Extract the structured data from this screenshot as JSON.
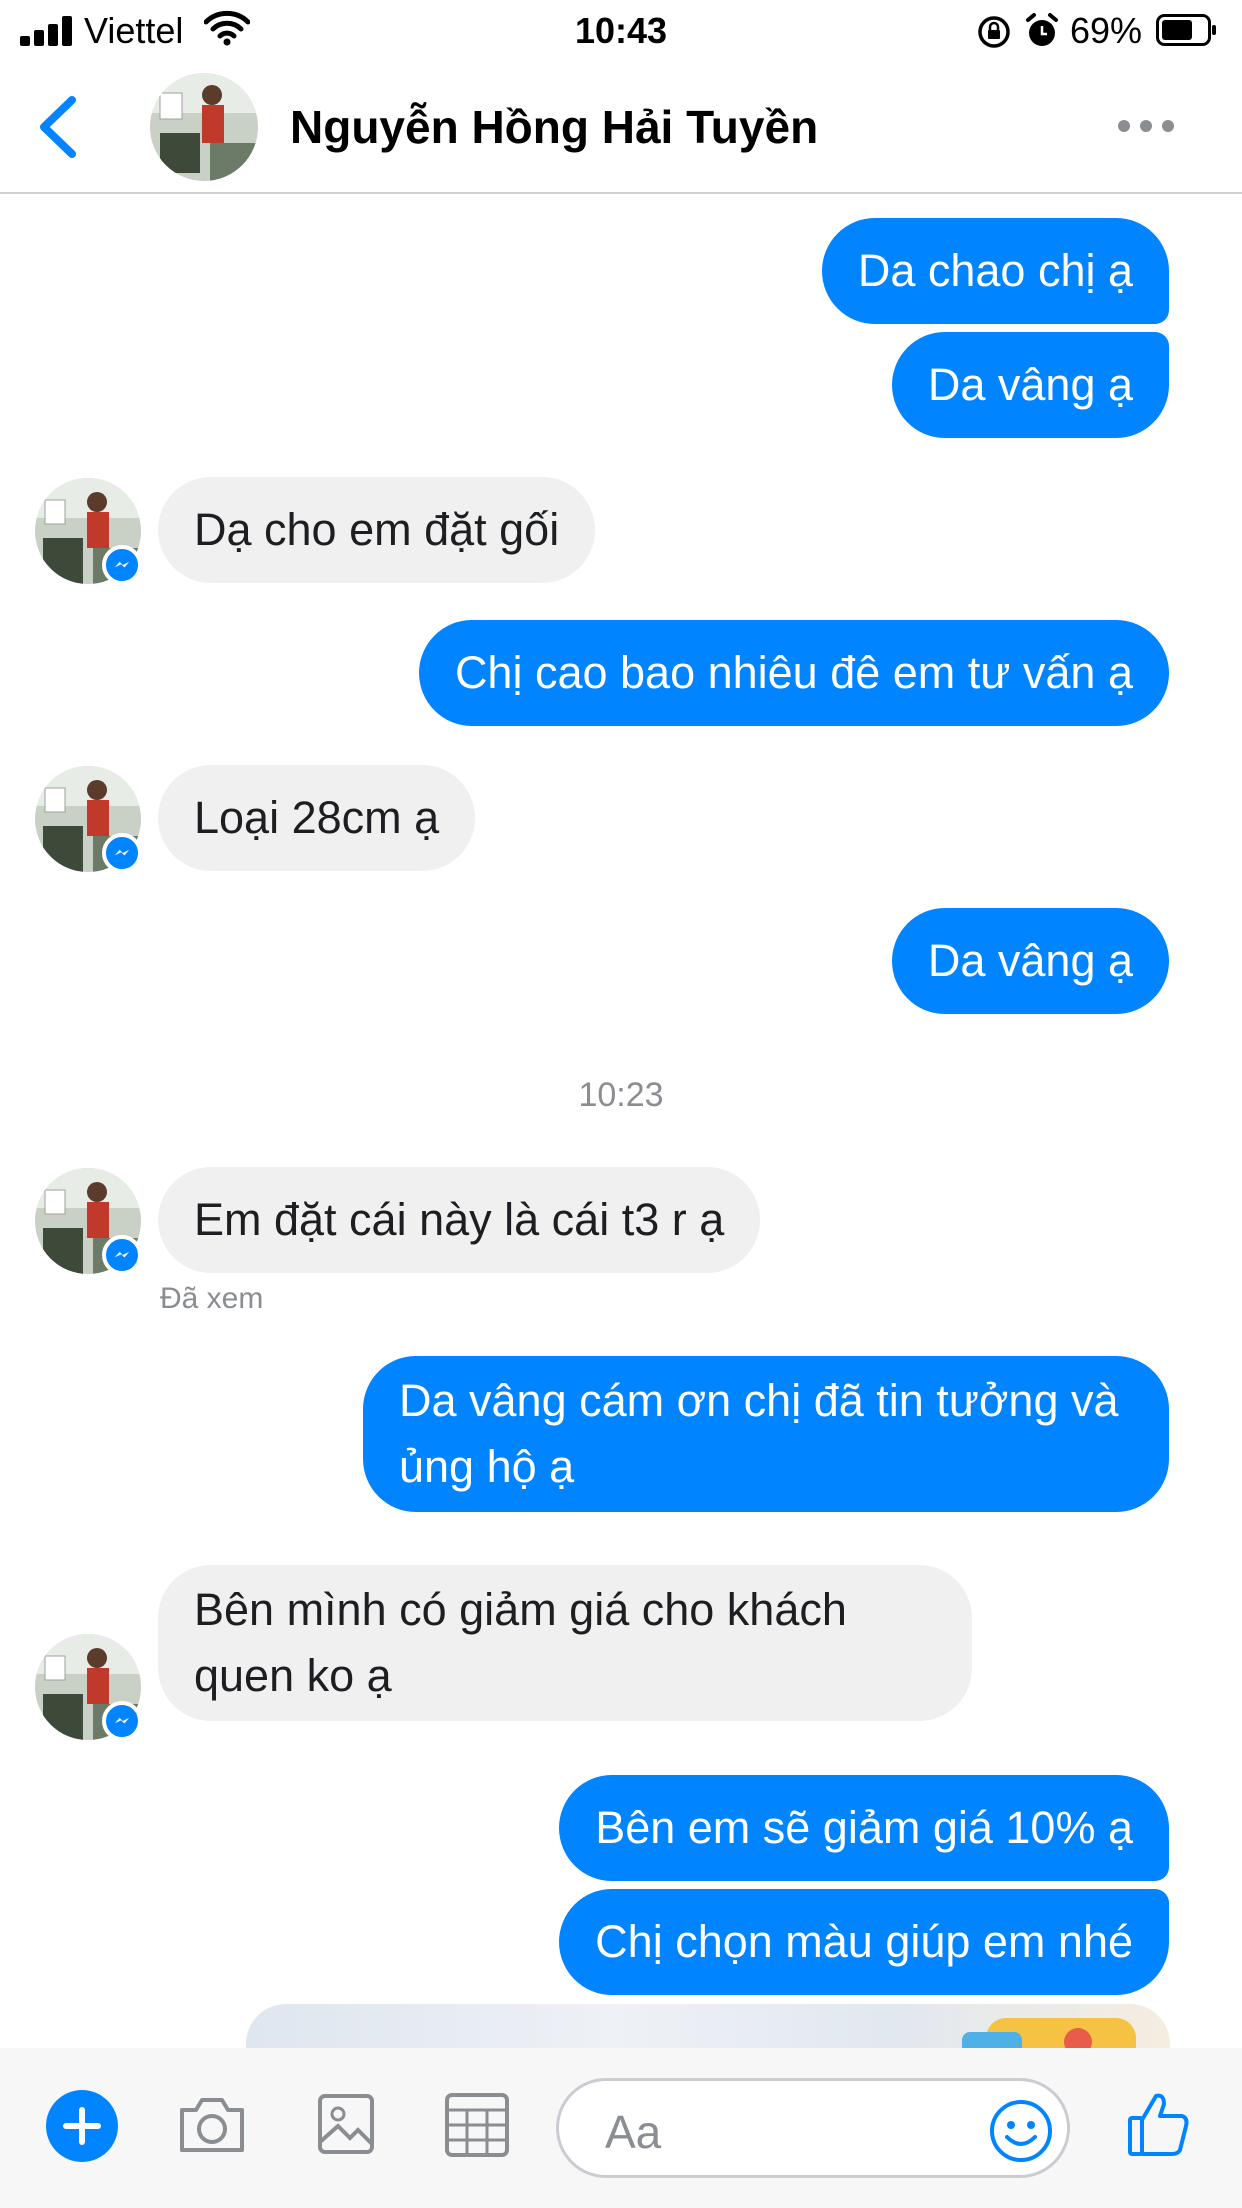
{
  "status_bar": {
    "carrier": "Viettel",
    "time": "10:43",
    "battery": "69%"
  },
  "header": {
    "contact_name": "Nguyễn Hồng Hải Tuyền"
  },
  "messages": [
    {
      "from": "me",
      "text": "Da chao chị ạ"
    },
    {
      "from": "me",
      "text": "Da vâng ạ"
    },
    {
      "from": "them",
      "text": "Dạ cho em đặt gối"
    },
    {
      "from": "me",
      "text": "Chị cao bao nhiêu đê em tư vấn ạ"
    },
    {
      "from": "them",
      "text": "Loại 28cm ạ"
    },
    {
      "from": "me",
      "text": "Da vâng ạ"
    },
    {
      "from": "them",
      "text": "Em đặt cái này là cái t3 r ạ"
    },
    {
      "from": "me",
      "text": "Da vâng cám ơn chị đã tin tưởng và ủng hộ ạ"
    },
    {
      "from": "them",
      "text": "Bên mình có giảm giá cho khách quen ko ạ"
    },
    {
      "from": "me",
      "text": "Bên em sẽ giảm giá 10% ạ"
    },
    {
      "from": "me",
      "text": "Chị chọn màu giúp em nhé"
    }
  ],
  "timestamp": "10:23",
  "seen_label": "Đã xem",
  "composer": {
    "placeholder": "Aa"
  },
  "colors": {
    "accent": "#0084ff",
    "incoming_bubble": "#f0f0f0"
  },
  "icons": [
    "back-icon",
    "more-icon",
    "plus-icon",
    "camera-icon",
    "image-icon",
    "grid-icon",
    "emoji-icon",
    "like-icon"
  ]
}
